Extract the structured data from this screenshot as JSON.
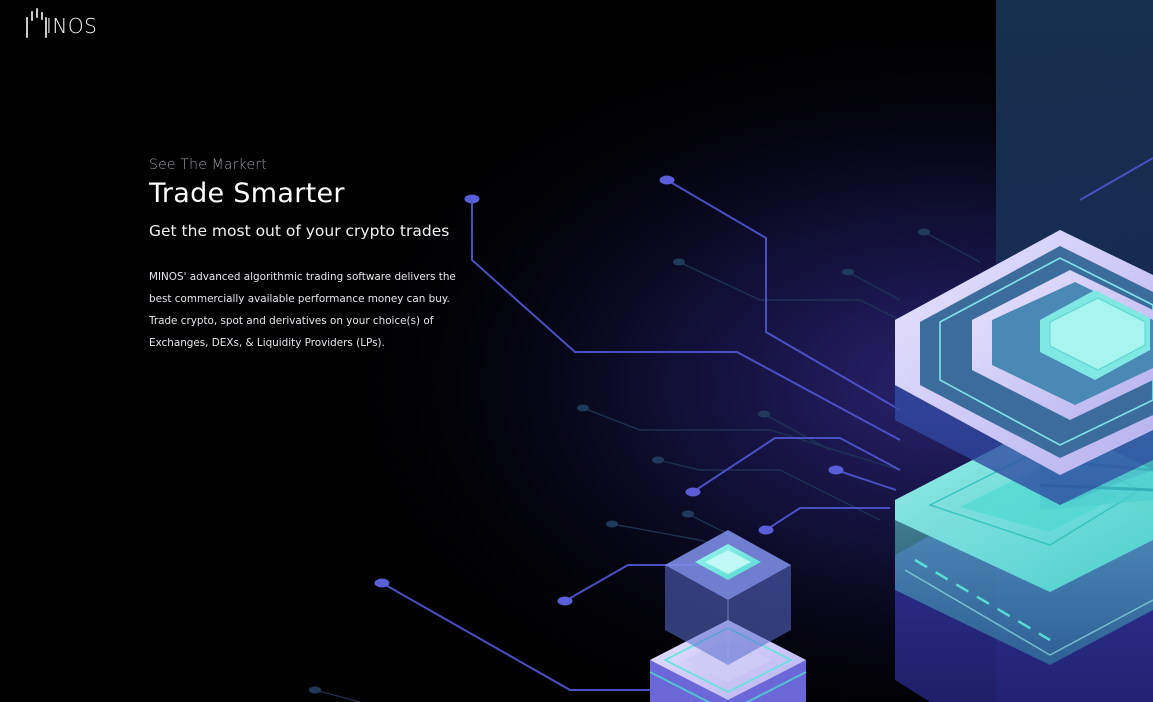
{
  "header": {
    "logo_text": "INOS",
    "logo_icon": "bar-chart-mark-icon"
  },
  "hero": {
    "eyebrow": "See The Markert",
    "headline": "Trade Smarter",
    "subheadline": "Get the most out of your crypto trades",
    "body_lines": [
      "MINOS' advanced algorithmic trading software delivers the",
      "best commercially available performance money can buy.",
      "Trade crypto, spot and derivatives on your choice(s) of",
      "Exchanges, DEXs, & Liquidity Providers (LPs)."
    ]
  },
  "colors": {
    "background": "#000000",
    "accent_purple": "#4a4fc4",
    "accent_cyan": "#5ee6dc",
    "accent_lavender": "#c9c3f5",
    "text_primary": "#ffffff",
    "text_muted": "#9a9aa4"
  },
  "illustration": {
    "name": "isometric-server-stack-illustration"
  }
}
